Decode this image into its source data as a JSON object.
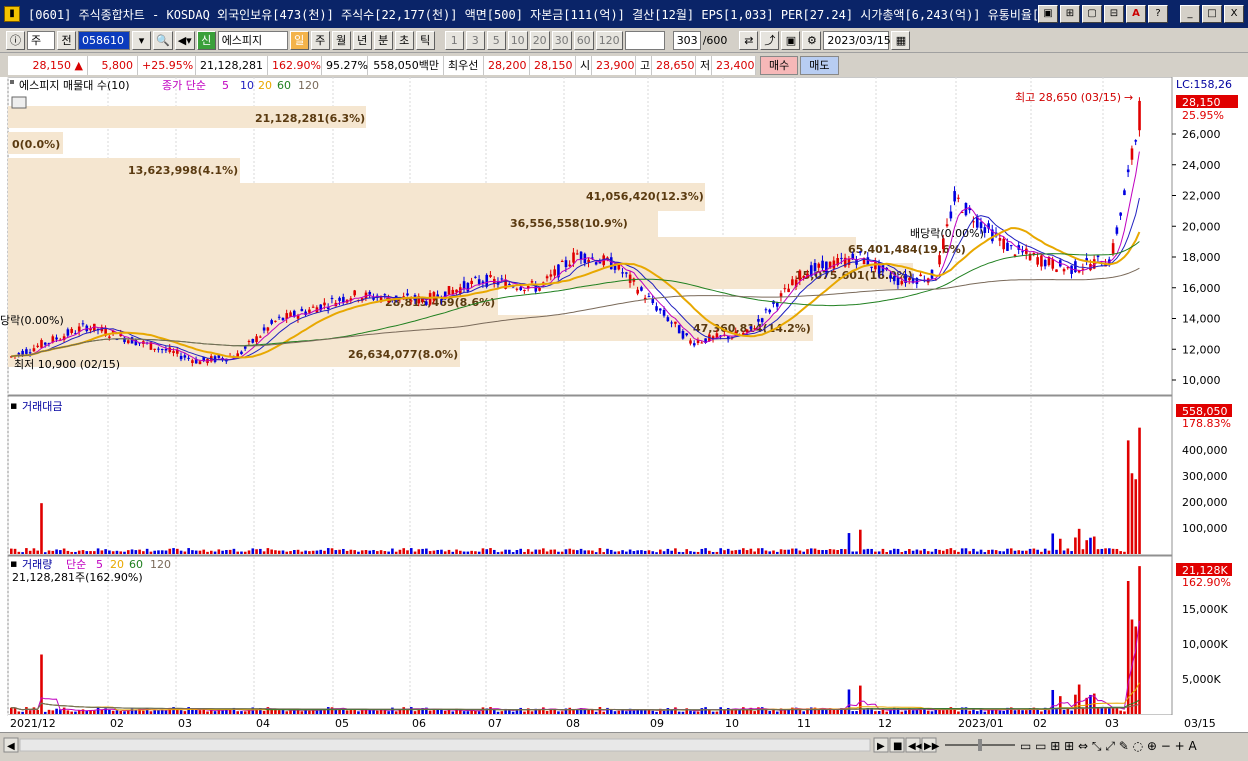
{
  "window": {
    "title": "[0601] 주식종합차트 - KOSDAQ 외국인보유[473(천)] 주식수[22,177(천)] 액면[500] 자본금[111(억)] 결산[12월] EPS[1,033] PER[27.24] 시가총액[6,243(억)] 유통비율[61.0]",
    "buttons": [
      "▣",
      "⊞",
      "▢",
      "⊟",
      "A",
      "?",
      "_",
      "□",
      "X"
    ]
  },
  "toolbar": {
    "period_type": "주",
    "prev_label": "전",
    "stock_code": "058610",
    "badge_new": "신",
    "stock_name": "에스피지",
    "periods": [
      "일",
      "주",
      "월",
      "년",
      "분",
      "초",
      "틱"
    ],
    "active_period": "일",
    "intervals": [
      "1",
      "3",
      "5",
      "10",
      "20",
      "30",
      "60",
      "120"
    ],
    "count": "303",
    "count_total": "/600",
    "date": "2023/03/15"
  },
  "quote": {
    "price": "28,150",
    "change": "5,800",
    "change_pct": "+25.95%",
    "volume": "21,128,281",
    "volume_ratio": "162.90%",
    "vol_pct2": "95.27%",
    "amount": "558,050백만",
    "best_label": "최우선",
    "best_ask": "28,200",
    "best_bid": "28,150",
    "open_label": "시",
    "open": "23,900",
    "high_label": "고",
    "high": "28,650",
    "low_label": "저",
    "low": "23,400",
    "buy_label": "매수",
    "sell_label": "매도"
  },
  "price_panel": {
    "legend_name": "에스피지 매물대 수(10)",
    "ma_label": "종가 단순",
    "ma_periods": [
      "5",
      "10",
      "20",
      "60",
      "120"
    ],
    "ma_colors": [
      "#c000c0",
      "#2020c0",
      "#e8a800",
      "#208020",
      "#7a6a5a"
    ],
    "lc_label": "LC:158,26",
    "current_tag": "28,150",
    "current_pct": "25.95%",
    "high_note": "최고 28,650 (03/15)",
    "low_note": "최저 10,900 (02/15)",
    "dividend_note": "배당락(0.00%)",
    "dividend_note_left": "당락(0.00%)",
    "y_ticks": [
      "26,000",
      "24,000",
      "22,000",
      "20,000",
      "18,000",
      "16,000",
      "14,000",
      "12,000",
      "10,000"
    ],
    "volume_profile": [
      {
        "label": "21,128,281(6.3%)"
      },
      {
        "label": "0(0.0%)"
      },
      {
        "label": "13,623,998(4.1%)"
      },
      {
        "label": "41,056,420(12.3%)"
      },
      {
        "label": "36,556,558(10.9%)"
      },
      {
        "label": "65,401,484(19.6%)"
      },
      {
        "label": "15,075,601(16.0%)"
      },
      {
        "label": "28,815,469(8.6%)"
      },
      {
        "label": "47,360,814(14.2%)"
      },
      {
        "label": "26,634,077(8.0%)"
      }
    ]
  },
  "amount_panel": {
    "legend_name": "거래대금",
    "current_tag": "558,050",
    "current_pct": "178.83%",
    "y_ticks": [
      "400,000",
      "300,000",
      "200,000",
      "100,000"
    ]
  },
  "volume_panel": {
    "legend_name": "거래량",
    "ma_label": "단순",
    "ma_periods": [
      "5",
      "20",
      "60",
      "120"
    ],
    "sub_label": "21,128,281주(162.90%)",
    "current_tag": "21,128K",
    "current_pct": "162.90%",
    "y_ticks": [
      "15,000K",
      "10,000K",
      "5,000K"
    ]
  },
  "x_axis": {
    "labels": [
      "2021/12",
      "02",
      "03",
      "04",
      "05",
      "06",
      "07",
      "08",
      "09",
      "10",
      "11",
      "12",
      "2023/01",
      "02",
      "03"
    ],
    "end_label": "03/15"
  },
  "colors": {
    "up": "#e00000",
    "down": "#0000e0",
    "profile": "#f5e6d0"
  }
}
